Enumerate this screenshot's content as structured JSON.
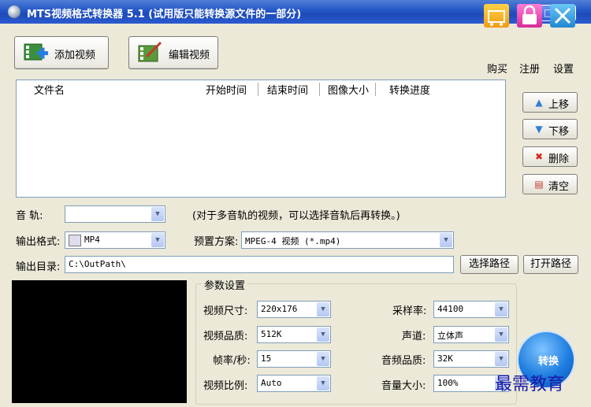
{
  "window": {
    "title": "MTS视频格式转换器 5.1 (试用版只能转换源文件的一部分)",
    "controls": {
      "minimize": "–",
      "maximize": "□",
      "close": "✕"
    }
  },
  "toolbar": {
    "add_video": "添加视频",
    "edit_video": "编辑视频",
    "buy": "购买",
    "register": "注册",
    "settings": "设置"
  },
  "file_list": {
    "columns": [
      "文件名",
      "开始时间",
      "结束时间",
      "图像大小",
      "转换进度"
    ],
    "rows": []
  },
  "side_buttons": {
    "move_up": "上移",
    "move_down": "下移",
    "delete": "删除",
    "clear": "清空"
  },
  "audio_track": {
    "label": "音    轨:",
    "value": "",
    "hint": "(对于多音轨的视频，可以选择音轨后再转换。)"
  },
  "output_format": {
    "label": "输出格式:",
    "value": "MP4"
  },
  "preset": {
    "label": "预置方案:",
    "value": "MPEG-4 视频 (*.mp4)"
  },
  "output_dir": {
    "label": "输出目录:",
    "value": "C:\\OutPath\\",
    "choose": "选择路径",
    "open": "打开路径"
  },
  "params": {
    "title": "参数设置",
    "video_size": {
      "label": "视频尺寸:",
      "value": "220x176"
    },
    "video_quality": {
      "label": "视频品质:",
      "value": "512K"
    },
    "frame_rate": {
      "label": "帧率/秒:",
      "value": "15"
    },
    "aspect": {
      "label": "视频比例:",
      "value": "Auto"
    },
    "sample_rate": {
      "label": "采样率:",
      "value": "44100"
    },
    "channels": {
      "label": "声道:",
      "value": "立体声"
    },
    "audio_quality": {
      "label": "音频品质:",
      "value": "32K"
    },
    "volume": {
      "label": "音量大小:",
      "value": "100%"
    }
  },
  "convert": {
    "label": "转换"
  },
  "watermark": "最需教育",
  "colors": {
    "title_bar": "#2456c6",
    "window_bg": "#ece9d8",
    "close_button": "#c23a17"
  }
}
